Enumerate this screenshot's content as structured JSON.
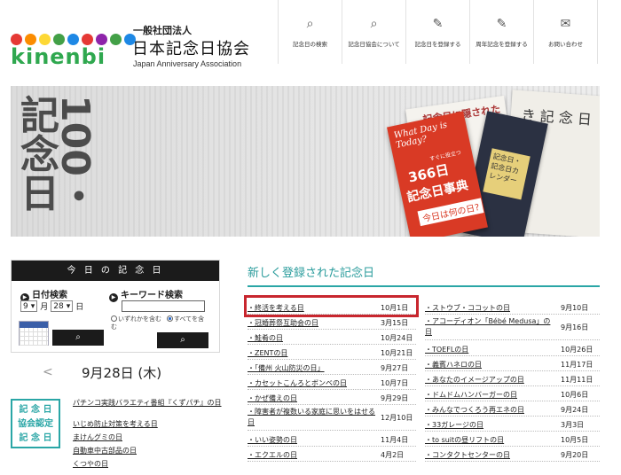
{
  "header": {
    "logo_word": "kinenbi",
    "org_type": "一般社団法人",
    "org_name": "日本記念日協会",
    "org_name_en": "Japan Anniversary Association",
    "logo_dot_colors": [
      "#e53935",
      "#fb8c00",
      "#fdd835",
      "#43a047",
      "#1e88e5",
      "#e53935",
      "#8e24aa",
      "#43a047",
      "#1e88e5"
    ]
  },
  "nav": [
    {
      "icon": "search-icon",
      "label": "記念日の検索"
    },
    {
      "icon": "search-icon",
      "label": "記念日協会について"
    },
    {
      "icon": "edit-icon",
      "label": "記念日を登録する"
    },
    {
      "icon": "edit-icon",
      "label": "周年記念を登録する"
    },
    {
      "icon": "mail-icon",
      "label": "お問い合わせ"
    }
  ],
  "hero": {
    "big_text": "100・記念日",
    "book_red_en": "What Day is Today?",
    "book_red_small": "すぐに役立つ",
    "book_red_title1": "366日",
    "book_red_title2": "記念日事典",
    "book_red_question": "今日は何の日?",
    "book_white_text": "記念日に隠された",
    "book_right_text": "き 記 念 日",
    "book_dark_label": "記念日・記念日カレンダー"
  },
  "today": {
    "header": "今 日 の 記 念 日",
    "date_search_label": "日付検索",
    "keyword_search_label": "キーワード検索",
    "month_value": "9",
    "day_value": "28",
    "month_suffix": "月",
    "day_suffix": "日",
    "radio_any": "いずれかを含む",
    "radio_all": "すべてを含",
    "radio_all_cont": "む",
    "date_display": "9月28日 (木)",
    "prev_arrow": "<"
  },
  "certified": {
    "badge_lines": [
      "記 念 日",
      "協会認定",
      "記 念 日"
    ],
    "items": [
      "パチンコ実践バラエティ番組『くずパチ』の日",
      "いじめ防止対策を考える日",
      "まけんグミの日",
      "自動車中古部品の日",
      "くつやの日"
    ]
  },
  "new_anniversaries": {
    "title": "新しく登録された記念日",
    "left": [
      {
        "name": "・終活を考える日",
        "date": "10月1日"
      },
      {
        "name": "・冠婚葬祭互助会の日",
        "date": "3月15日"
      },
      {
        "name": "・鮭肴の日",
        "date": "10月24日"
      },
      {
        "name": "・ZENTの日",
        "date": "10月21日"
      },
      {
        "name": "・「備州 火山防災の日」",
        "date": "9月27日"
      },
      {
        "name": "・カセットこんろとボンベの日",
        "date": "10月7日"
      },
      {
        "name": "・かぜ備えの日",
        "date": "9月29日"
      },
      {
        "name": "・障害者が複数いる家庭に思いをはせる日",
        "date": "12月10日"
      },
      {
        "name": "・いい姿勢の日",
        "date": "11月4日"
      },
      {
        "name": "・エクエルの日",
        "date": "4月2日"
      }
    ],
    "right": [
      {
        "name": "・ストウブ・ココットの日",
        "date": "9月10日"
      },
      {
        "name": "・アコーディオン「Bébé Medusa」の日",
        "date": "9月16日"
      },
      {
        "name": "・TOEFLの日",
        "date": "10月26日"
      },
      {
        "name": "・義賓ハネロの日",
        "date": "11月17日"
      },
      {
        "name": "・あなたのイメージアップの日",
        "date": "11月11日"
      },
      {
        "name": "・ドムドムハンバーガーの日",
        "date": "10月6日"
      },
      {
        "name": "・みんなでつくろう再エネの日",
        "date": "9月24日"
      },
      {
        "name": "・33ガレージの日",
        "date": "3月3日"
      },
      {
        "name": "・to suitの昼リフトの日",
        "date": "10月5日"
      },
      {
        "name": "・コンタクトセンターの日",
        "date": "9月20日"
      }
    ]
  },
  "colors": {
    "accent": "#2aa6a6",
    "highlight": "#c8262e",
    "dark": "#1b1b1b"
  }
}
